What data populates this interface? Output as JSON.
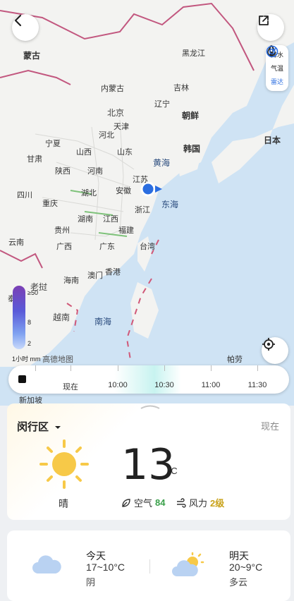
{
  "map": {
    "labels": {
      "mongolia": "蒙古",
      "inner_mongolia": "内蒙古",
      "heilongjiang": "黑龙江",
      "jilin": "吉林",
      "liaoning": "辽宁",
      "beijing": "北京",
      "tianjin": "天津",
      "hebei": "河北",
      "ningxia": "宁夏",
      "shanxi": "山西",
      "shandong": "山东",
      "gansu": "甘肃",
      "shaanxi": "陕西",
      "henan": "河南",
      "jiangsu": "江苏",
      "sichuan": "四川",
      "hubei": "湖北",
      "anhui": "安徽",
      "chongqing": "重庆",
      "zhejiang": "浙江",
      "hunan": "湖南",
      "jiangxi": "江西",
      "guizhou": "贵州",
      "fujian": "福建",
      "yunnan": "云南",
      "guangxi": "广西",
      "guangdong": "广东",
      "taiwan": "台湾",
      "macau": "澳门",
      "hongkong": "香港",
      "hainan": "海南",
      "laos": "老挝",
      "vietnam": "越南",
      "north_korea": "朝鲜",
      "south_korea": "韩国",
      "japan": "日本",
      "yellow_sea": "黄海",
      "east_sea": "东海",
      "south_sea": "南海",
      "palau": "帕劳",
      "singapore": "新加坡",
      "thailand_partial": "泰",
      "attribution": "高德地图"
    },
    "layers": {
      "precip": "降水",
      "temp": "气温",
      "radar": "雷达"
    },
    "legend": {
      "top": "≥50",
      "mid": "8",
      "low": "2",
      "unit": "1小时 mm"
    }
  },
  "timeline": {
    "labels": [
      "现在",
      "10:00",
      "10:30",
      "11:00",
      "11:30"
    ]
  },
  "weather": {
    "district": "闵行区",
    "now_label": "现在",
    "temp": "13",
    "unit": "°C",
    "condition": "晴",
    "air_label": "空气",
    "air_value": "84",
    "wind_label": "风力",
    "wind_value": "2级"
  },
  "forecast": {
    "today_label": "今天",
    "today_range": "17~10°C",
    "today_cond": "阴",
    "tomorrow_label": "明天",
    "tomorrow_range": "20~9°C",
    "tomorrow_cond": "多云"
  },
  "colors": {
    "accent": "#2a6de0",
    "air_good": "#3aa04a",
    "wind": "#c9a21a",
    "sun": "#f7c948"
  }
}
